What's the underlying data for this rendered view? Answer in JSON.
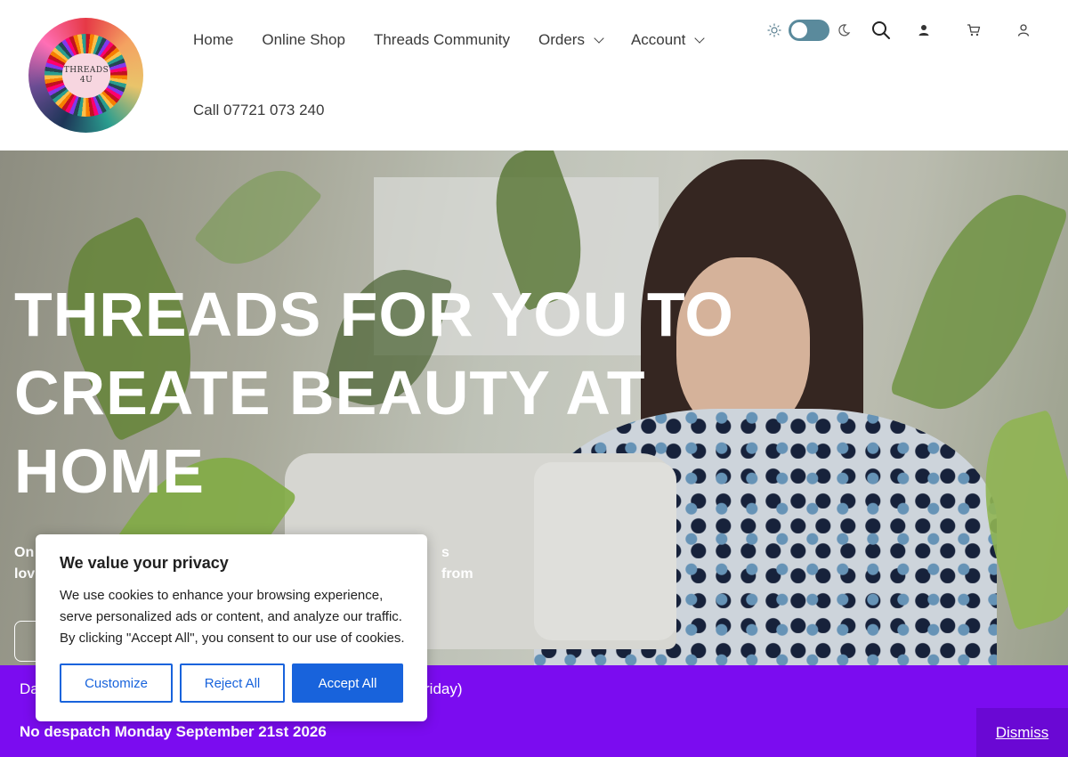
{
  "header": {
    "logo": {
      "lines": [
        "THREADS",
        "4U"
      ]
    },
    "nav": [
      {
        "label": "Home",
        "has_dropdown": false
      },
      {
        "label": "Online Shop",
        "has_dropdown": false
      },
      {
        "label": "Threads Community",
        "has_dropdown": false
      },
      {
        "label": "Orders",
        "has_dropdown": true
      },
      {
        "label": "Account",
        "has_dropdown": true
      }
    ],
    "call_label": "Call 07721 073 240",
    "tools": {
      "theme_toggle": {
        "icons": [
          "sun-icon",
          "moon-icon"
        ],
        "mode": "light",
        "accent": "#5a8a9c"
      },
      "icons": [
        "search-icon",
        "user-icon",
        "cart-icon",
        "account-icon"
      ]
    }
  },
  "hero": {
    "title": "THREADS FOR YOU TO CREATE BEAUTY AT HOME",
    "subtitle_visible_start": "On",
    "subtitle_visible_line2_start": "lov",
    "subtitle_visible_end": "s from"
  },
  "notice": {
    "line1_start": "Da",
    "line1_end": "riday)",
    "line2": "No despatch Monday September 21st 2026",
    "dismiss_label": "Dismiss",
    "background": "#7b0cf0"
  },
  "cookie": {
    "title": "We value your privacy",
    "text": "We use cookies to enhance your browsing experience, serve personalized ads or content, and analyze our traffic. By clicking \"Accept All\", you consent to our use of cookies.",
    "buttons": {
      "customize": "Customize",
      "reject": "Reject All",
      "accept": "Accept All"
    },
    "accent": "#1863dc"
  }
}
